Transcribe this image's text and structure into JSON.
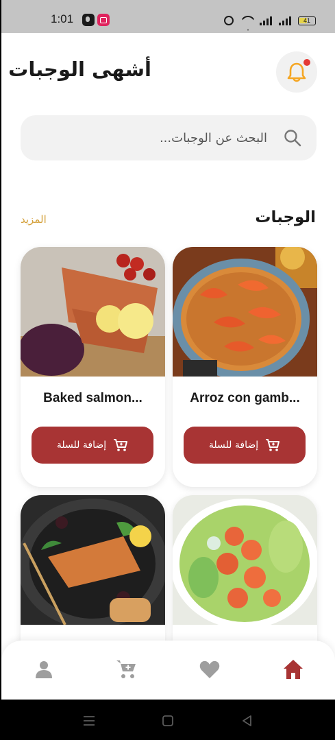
{
  "status_bar": {
    "time": "1:01",
    "battery": "41"
  },
  "header": {
    "title": "أشهى الوجبات",
    "bell_icon": "bell-icon",
    "accent_color": "#f5a623"
  },
  "search": {
    "placeholder": "البحث عن الوجبات..."
  },
  "section": {
    "title": "الوجبات",
    "more_label": "المزيد"
  },
  "meals": [
    {
      "title": "Arroz con gamb...",
      "add_label": "إضافة للسلة"
    },
    {
      "title": "Baked salmon...",
      "add_label": "إضافة للسلة"
    },
    {
      "title": "",
      "add_label": ""
    },
    {
      "title": "",
      "add_label": ""
    }
  ],
  "bottom_nav": {
    "items": [
      "profile-icon",
      "cart-icon",
      "heart-icon",
      "home-icon"
    ],
    "active": "home-icon",
    "active_color": "#a83434",
    "inactive_color": "#9e9e9e"
  },
  "colors": {
    "button": "#a83434",
    "more_link": "#d4a03a"
  }
}
